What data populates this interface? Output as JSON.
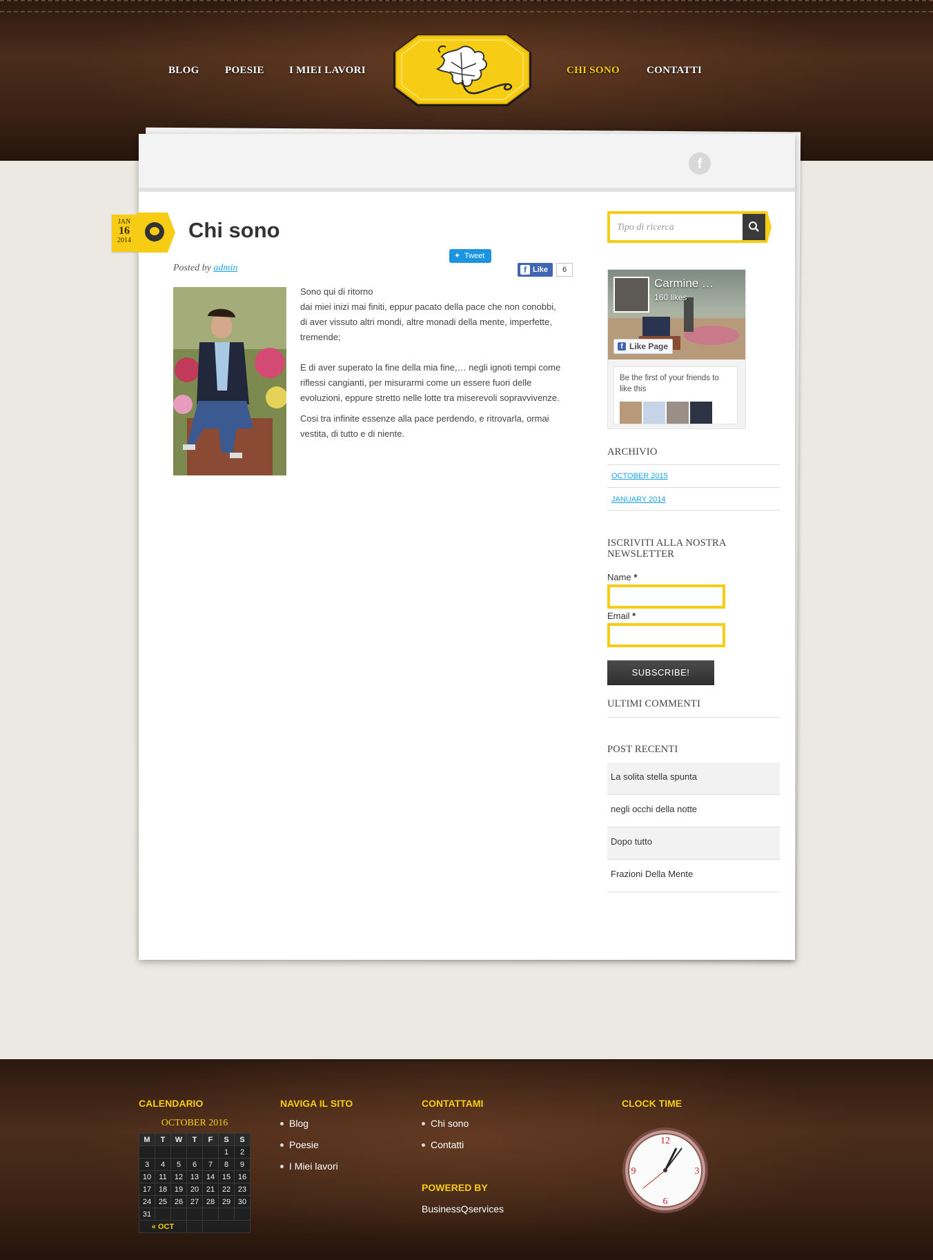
{
  "nav": {
    "items": [
      {
        "label": "BLOG"
      },
      {
        "label": "POESIE"
      },
      {
        "label": "I MIEI LAVORI"
      },
      {
        "label": "CHI SONO",
        "active": true
      },
      {
        "label": "CONTATTI"
      }
    ]
  },
  "post": {
    "date": {
      "month": "JAN",
      "day": "16",
      "year": "2014"
    },
    "title": "Chi sono",
    "posted_by_label": "Posted by",
    "author": "admin",
    "tweet_label": "Tweet",
    "like_label": "Like",
    "like_count": "6",
    "paragraphs": [
      "Sono qui di ritorno\ndai miei inizi mai finiti, eppur pacato della pace che non conobbi,\ndi aver vissuto altri mondi, altre monadi della mente, imperfette, tremende;",
      "E di aver superato la fine della mia fine,… negli ignoti tempi come riflessi cangianti, per misurarmi come un essere fuori delle evoluzioni, eppure stretto nelle lotte tra miserevoli sopravvivenze.",
      "Cosi tra infinite essenze alla pace perdendo, e ritrovarla, ormai vestita, di tutto e di niente."
    ]
  },
  "sidebar": {
    "search_placeholder": "Tipo di ricerca",
    "fb": {
      "name": "Carmine …",
      "likes": "160 likes",
      "like_page": "Like Page",
      "friends_text": "Be the first of your friends to like this"
    },
    "archive": {
      "title": "ARCHIVIO",
      "links": [
        "OCTOBER 2015",
        "JANUARY 2014"
      ]
    },
    "newsletter": {
      "title": "ISCRIVITI ALLA NOSTRA NEWSLETTER",
      "name_label": "Name",
      "email_label": "Email",
      "required_mark": "*",
      "subscribe": "SUBSCRIBE!"
    },
    "comments_title": "ULTIMI COMMENTI",
    "recent": {
      "title": "POST RECENTI",
      "items": [
        "La solita stella spunta",
        "negli occhi della notte",
        "Dopo tutto",
        "Frazioni Della Mente"
      ]
    }
  },
  "footer": {
    "calendar": {
      "title": "CALENDARIO",
      "caption": "OCTOBER 2016",
      "weekdays": [
        "M",
        "T",
        "W",
        "T",
        "F",
        "S",
        "S"
      ],
      "weeks": [
        [
          "",
          "",
          "",
          "",
          "",
          "1",
          "2"
        ],
        [
          "3",
          "4",
          "5",
          "6",
          "7",
          "8",
          "9"
        ],
        [
          "10",
          "11",
          "12",
          "13",
          "14",
          "15",
          "16"
        ],
        [
          "17",
          "18",
          "19",
          "20",
          "21",
          "22",
          "23"
        ],
        [
          "24",
          "25",
          "26",
          "27",
          "28",
          "29",
          "30"
        ],
        [
          "31",
          "",
          "",
          "",
          "",
          "",
          ""
        ]
      ],
      "prev_link": "« OCT"
    },
    "nav": {
      "title": "NAVIGA IL SITO",
      "items": [
        "Blog",
        "Poesie",
        "I Miei lavori"
      ]
    },
    "contact": {
      "title": "CONTATTAMI",
      "items": [
        "Chi sono",
        "Contatti"
      ]
    },
    "powered": {
      "title": "POWERED BY",
      "text": "BusinessQservices"
    },
    "clock": {
      "title": "CLOCK TIME",
      "numerals": [
        "12",
        "3",
        "6",
        "9"
      ]
    }
  },
  "colors": {
    "accent": "#f7cc14",
    "link": "#1aa3e3",
    "leather": "#3b2315"
  }
}
